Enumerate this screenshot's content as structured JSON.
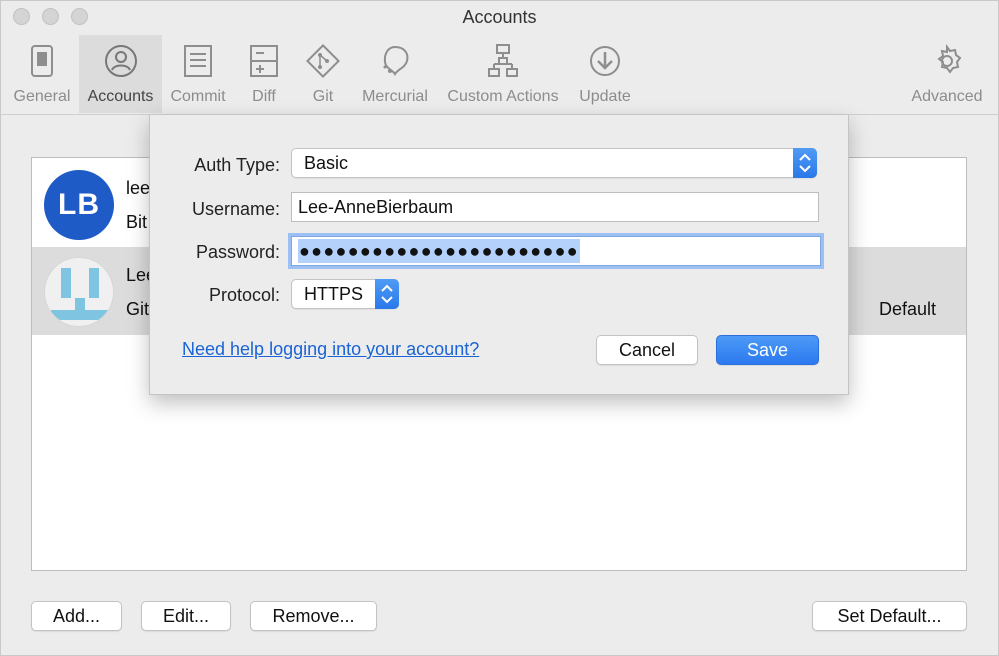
{
  "window": {
    "title": "Accounts"
  },
  "toolbar": {
    "tabs": [
      {
        "label": "General",
        "icon": "switch-icon"
      },
      {
        "label": "Accounts",
        "icon": "user-icon",
        "active": true
      },
      {
        "label": "Commit",
        "icon": "document-icon"
      },
      {
        "label": "Diff",
        "icon": "diff-icon"
      },
      {
        "label": "Git",
        "icon": "git-icon"
      },
      {
        "label": "Mercurial",
        "icon": "mercurial-icon"
      },
      {
        "label": "Custom Actions",
        "icon": "hierarchy-icon"
      },
      {
        "label": "Update",
        "icon": "download-icon"
      },
      {
        "label": "Advanced",
        "icon": "gear-icon"
      }
    ]
  },
  "accounts": [
    {
      "avatar_text": "LB",
      "name": "lee",
      "service": "Bit"
    },
    {
      "avatar_text": "",
      "name": "Lee",
      "service": "Git",
      "default_label": "Default"
    }
  ],
  "bottom_buttons": {
    "add": "Add...",
    "edit": "Edit...",
    "remove": "Remove...",
    "set_default": "Set Default..."
  },
  "dialog": {
    "auth_type_label": "Auth Type:",
    "auth_type_value": "Basic",
    "username_label": "Username:",
    "username_value": "Lee-AnneBierbaum",
    "password_label": "Password:",
    "password_masked": "●●●●●●●●●●●●●●●●●●●●●●●",
    "protocol_label": "Protocol:",
    "protocol_value": "HTTPS",
    "help_link": "Need help logging into your account?",
    "cancel": "Cancel",
    "save": "Save"
  },
  "colors": {
    "accent": "#2b79ef",
    "avatar_lb": "#1e5bc6",
    "link": "#1a64d6",
    "github_avatar": "#7fc4e0"
  }
}
